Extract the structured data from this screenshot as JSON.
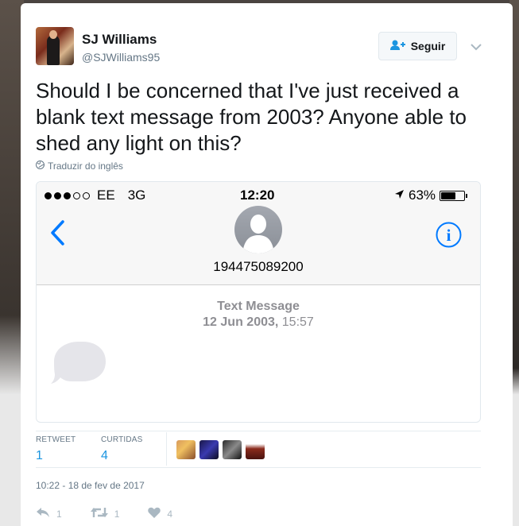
{
  "user": {
    "display_name": "SJ Williams",
    "handle": "@SJWilliams95"
  },
  "follow_button": {
    "label": "Seguir",
    "icon": "add-user-icon"
  },
  "tweet": {
    "text": "Should I be concerned that I've just received a blank text message from 2003? Anyone able to shed any light on this?",
    "translate_label": "Traduzir do inglês",
    "timestamp": "10:22 - 18 de fev de 2017"
  },
  "screenshot": {
    "status_bar": {
      "carrier": "EE",
      "network": "3G",
      "time": "12:20",
      "battery_percent": "63%",
      "battery_level": 0.63
    },
    "contact_number": "194475089200",
    "message_label": "Text Message",
    "message_date_bold": "12 Jun 2003,",
    "message_time": "15:57"
  },
  "stats": {
    "retweets_label": "RETWEET",
    "retweets_value": "1",
    "likes_label": "CURTIDAS",
    "likes_value": "4"
  },
  "actions": {
    "reply_count": "1",
    "retweet_count": "1",
    "like_count": "4"
  },
  "colors": {
    "accent": "#1b95e0",
    "ios_blue": "#007aff",
    "muted": "#657786"
  }
}
